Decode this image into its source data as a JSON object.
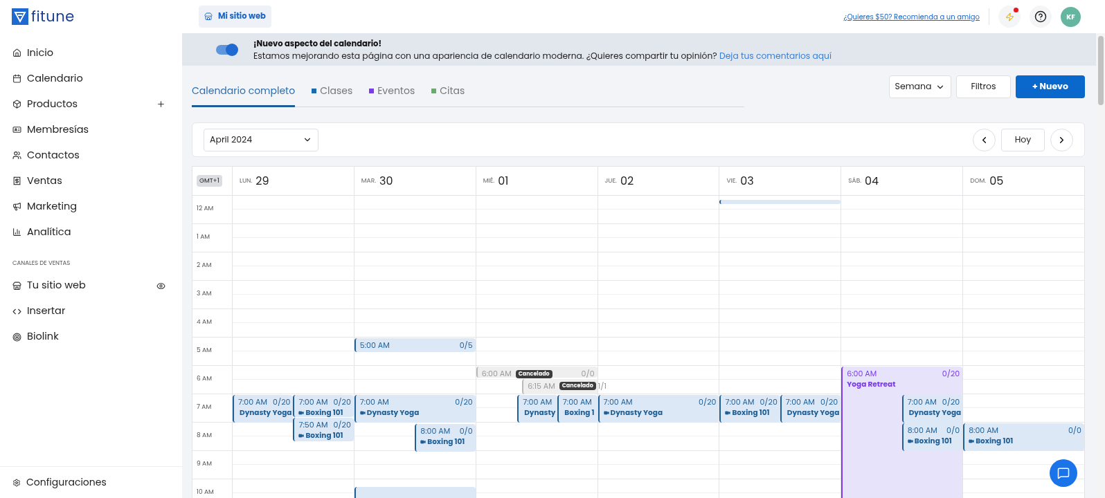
{
  "brand": {
    "name": "fitune"
  },
  "header": {
    "site_button": "Mi sitio web",
    "referral_link": "¿Quieres $50? Recomienda a un amigo",
    "notification_dot": true,
    "avatar": "KF"
  },
  "sidebar": {
    "items": [
      {
        "label": "Inicio"
      },
      {
        "label": "Calendario"
      },
      {
        "label": "Productos"
      },
      {
        "label": "Membresías"
      },
      {
        "label": "Contactos"
      },
      {
        "label": "Ventas"
      },
      {
        "label": "Marketing"
      },
      {
        "label": "Analítica"
      }
    ],
    "section_title": "CANALES DE VENTAS",
    "channels": [
      {
        "label": "Tu sitio web"
      },
      {
        "label": "Insertar"
      },
      {
        "label": "Biolink"
      }
    ],
    "footer": "Configuraciones"
  },
  "banner": {
    "on": true,
    "title": "¡Nuevo aspecto del calendario!",
    "text": "Estamos mejorando esta página con una apariencia de calendario moderna. ¿Quieres compartir tu opinión?",
    "link": "Deja tus comentarios aquí"
  },
  "tabs": [
    {
      "label": "Calendario completo",
      "selected": true
    },
    {
      "label": "Clases",
      "selected": false,
      "color": "#1e6aa8"
    },
    {
      "label": "Eventos",
      "selected": false,
      "color": "#7c3aed"
    },
    {
      "label": "Citas",
      "selected": false,
      "color": "#6aaa6a"
    }
  ],
  "toolbar": {
    "view": "Semana",
    "filters": "Filtros",
    "new": "+ Nuevo"
  },
  "month_select": "April 2024",
  "today": "Hoy",
  "timezone": "GMT+1",
  "days": [
    {
      "dow": "LUN.",
      "num": "29"
    },
    {
      "dow": "MAR.",
      "num": "30"
    },
    {
      "dow": "MIÉ.",
      "num": "01"
    },
    {
      "dow": "JUE.",
      "num": "02"
    },
    {
      "dow": "VIE.",
      "num": "03"
    },
    {
      "dow": "SÁB.",
      "num": "04"
    },
    {
      "dow": "DOM.",
      "num": "05"
    }
  ],
  "hours": [
    "12 AM",
    "1 AM",
    "2 AM",
    "3 AM",
    "4 AM",
    "5 AM",
    "6 AM",
    "7 AM",
    "8 AM",
    "9 AM",
    "10 AM"
  ],
  "events": [
    {
      "kind": "class",
      "cancelled": false,
      "time": "7:00 AM",
      "capacity": "0/20",
      "name": "Dynasty Yoga"
    },
    {
      "kind": "class",
      "cancelled": false,
      "time": "7:00 AM",
      "capacity": "0/20",
      "name": "Boxing 101"
    },
    {
      "kind": "class",
      "cancelled": false,
      "time": "7:50 AM",
      "capacity": "0/20",
      "name": "Boxing 101"
    },
    {
      "kind": "class",
      "cancelled": false,
      "time": "5:00 AM",
      "capacity": "0/5"
    },
    {
      "kind": "class",
      "cancelled": false,
      "time": "7:00 AM",
      "capacity": "0/20",
      "name": "Dynasty Yoga"
    },
    {
      "kind": "class",
      "cancelled": false,
      "time": "8:00 AM",
      "capacity": "0/0",
      "name": "Boxing 101"
    },
    {
      "kind": "class",
      "cancelled": false
    },
    {
      "kind": "class",
      "cancelled": true,
      "time": "6:00 AM",
      "capacity": "0/0",
      "badge": "Cancelado"
    },
    {
      "kind": "appointment",
      "cancelled": true,
      "time": "6:15 AM",
      "capacity": "1/1",
      "badge": "Cancelado"
    },
    {
      "kind": "class",
      "cancelled": false,
      "time": "7:00 AM",
      "name": "Dynasty"
    },
    {
      "kind": "class",
      "cancelled": false,
      "time": "7:00 AM",
      "name": "Boxing 1"
    },
    {
      "kind": "class",
      "cancelled": false,
      "time": "7:00 AM",
      "capacity": "0/20",
      "name": "Dynasty Yoga"
    },
    {
      "kind": "class",
      "cancelled": false
    },
    {
      "kind": "class",
      "cancelled": false,
      "time": "7:00 AM",
      "capacity": "0/20",
      "name": "Boxing 101"
    },
    {
      "kind": "class",
      "cancelled": false,
      "time": "7:00 AM",
      "capacity": "0/20",
      "name": "Dynasty Yoga"
    },
    {
      "kind": "event",
      "cancelled": false,
      "time": "6:00 AM",
      "capacity": "0/20",
      "name": "Yoga Retreat"
    },
    {
      "kind": "class",
      "cancelled": false,
      "time": "7:00 AM",
      "capacity": "0/20",
      "name": "Dynasty Yoga"
    },
    {
      "kind": "class",
      "cancelled": false,
      "time": "8:00 AM",
      "capacity": "0/0",
      "name": "Boxing 101"
    },
    {
      "kind": "class",
      "cancelled": false,
      "time": "8:00 AM",
      "capacity": "0/0",
      "name": "Boxing 101"
    }
  ]
}
